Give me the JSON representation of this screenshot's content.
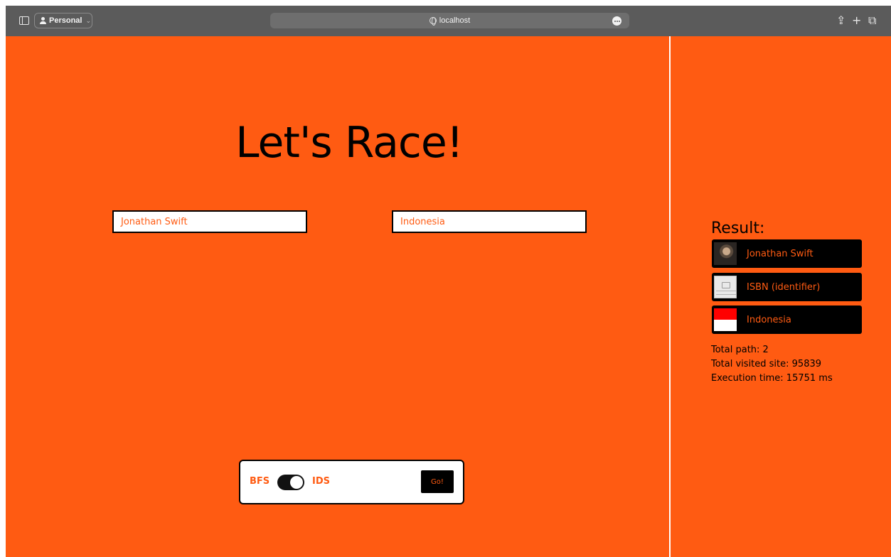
{
  "browser": {
    "profile_label": "Personal",
    "address": "localhost",
    "icons": [
      "sidebar-icon",
      "person-icon",
      "chevron-down-icon",
      "globe-icon",
      "more-icon",
      "share-icon",
      "plus-icon",
      "tabs-icon"
    ]
  },
  "page": {
    "title": "Let's Race!",
    "start_input": {
      "value": "Jonathan Swift"
    },
    "target_input": {
      "value": "Indonesia"
    },
    "algorithm": {
      "left_label": "BFS",
      "right_label": "IDS",
      "selected": "IDS"
    },
    "go_label": "Go!"
  },
  "result": {
    "heading": "Result:",
    "items": [
      {
        "label": "Jonathan Swift",
        "thumbnail": "portrait"
      },
      {
        "label": "ISBN (identifier)",
        "thumbnail": "no-image-placeholder"
      },
      {
        "label": "Indonesia",
        "thumbnail": "flag-red-white"
      }
    ],
    "stats": {
      "total_path": "Total path: 2",
      "total_visited": "Total visited site: 95839",
      "execution_time": "Execution time: 15751 ms"
    }
  },
  "colors": {
    "background": "#ff5b12",
    "accent_text": "#ff5b12",
    "panel": "#ffffff",
    "result_item": "#000000"
  }
}
